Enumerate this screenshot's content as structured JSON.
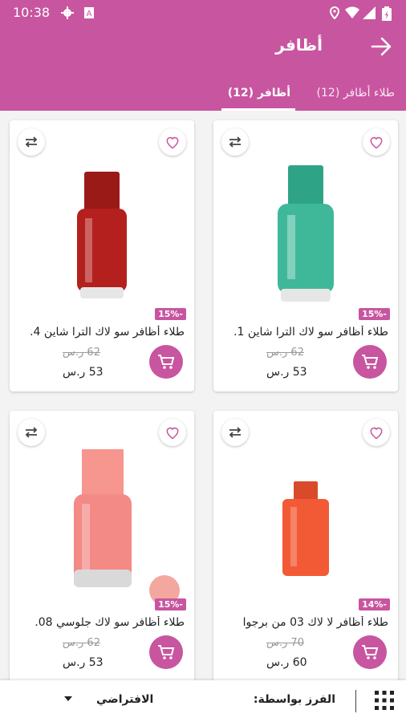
{
  "status_bar": {
    "time": "10:38"
  },
  "app_bar": {
    "title": "أظافر"
  },
  "tabs": [
    {
      "label": "طلاء أظافر (12)",
      "active": false
    },
    {
      "label": "أظافر (12)",
      "active": true
    }
  ],
  "products": [
    {
      "name": "طلاء أظافر سو لاك الترا شاين 1.",
      "discount": "15%-",
      "old_price": "62 ر.س",
      "new_price": "53 ر.س",
      "bottle_color": "#3fb89a"
    },
    {
      "name": "طلاء أظافر سو لاك الترا شاين 4.",
      "discount": "15%-",
      "old_price": "62 ر.س",
      "new_price": "53 ر.س",
      "bottle_color": "#b3201e"
    },
    {
      "name": "طلاء أظافر لا لاك 03 من برجوا",
      "discount": "14%-",
      "old_price": "70 ر.س",
      "new_price": "60 ر.س",
      "bottle_color": "#f25a35"
    },
    {
      "name": "طلاء أظافر سو لاك جلوسي 08.",
      "discount": "15%-",
      "old_price": "62 ر.س",
      "new_price": "53 ر.س",
      "bottle_color": "#f38a86"
    }
  ],
  "bottom_bar": {
    "sort_label": "الفرز بواسطة:",
    "sort_value": "الافتراضي"
  },
  "colors": {
    "accent": "#c8559f"
  }
}
